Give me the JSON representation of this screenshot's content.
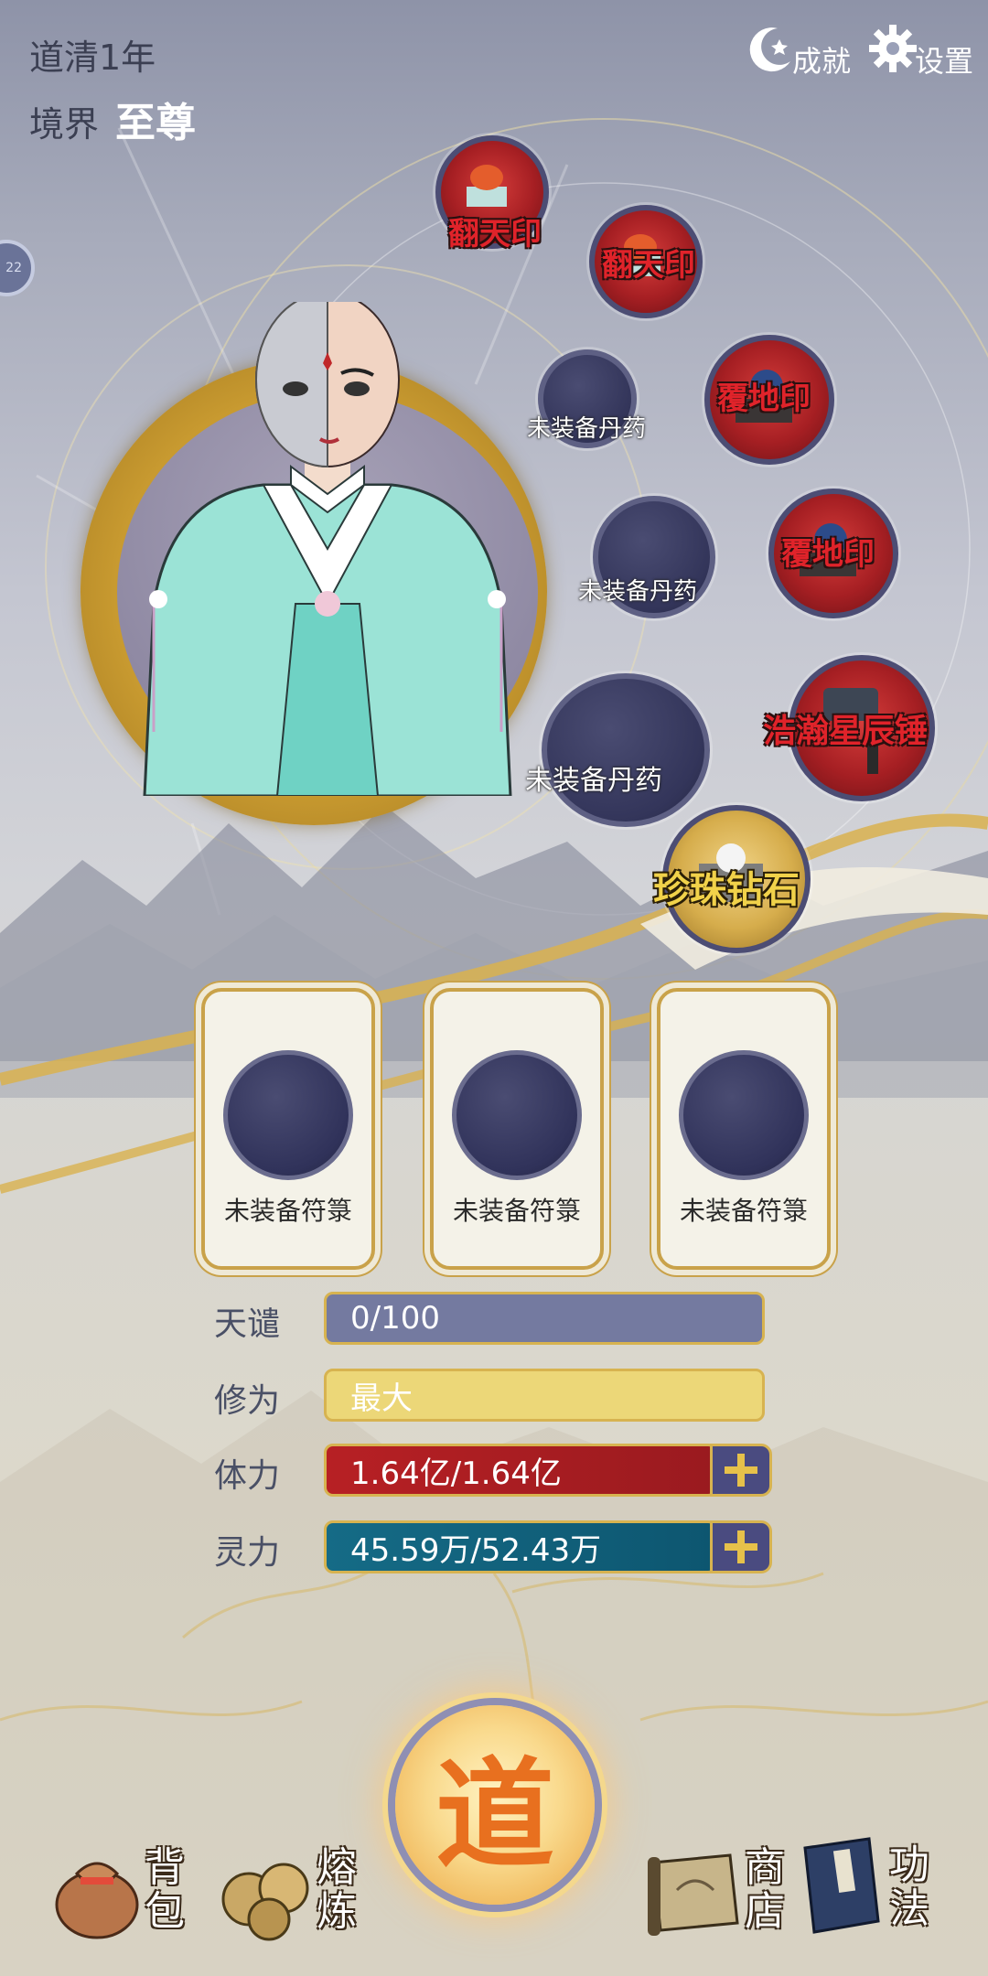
{
  "header": {
    "daoqing": "道清1年",
    "realm_label": "境界",
    "realm_value": "至尊",
    "achievement_label": "成就",
    "settings_label": "设置"
  },
  "side_tab": {
    "label": "22"
  },
  "equipment": {
    "seal1": "翻天印",
    "seal2": "翻天印",
    "earth1": "覆地印",
    "earth2": "覆地印",
    "hammer": "浩瀚星辰锤",
    "gem": "珍珠钻石",
    "pill1": "未装备丹药",
    "pill2": "未装备丹药",
    "pill3": "未装备丹药"
  },
  "talismans": [
    "未装备符箓",
    "未装备符箓",
    "未装备符箓"
  ],
  "stats": {
    "tianqian_label": "天谴",
    "tianqian_value": "0/100",
    "xiuwei_label": "修为",
    "xiuwei_value": "最大",
    "tili_label": "体力",
    "tili_value": "1.64亿/1.64亿",
    "lingli_label": "灵力",
    "lingli_value": "45.59万/52.43万"
  },
  "nav": {
    "bag_1": "背",
    "bag_2": "包",
    "smelt_1": "熔",
    "smelt_2": "炼",
    "dao": "道",
    "shop_1": "商",
    "shop_2": "店",
    "skill_1": "功",
    "skill_2": "法"
  },
  "colors": {
    "accent_gold": "#d7b350",
    "health_red": "#b72024",
    "mana_teal": "#156b86",
    "cultivation_yellow": "#ecd778",
    "wrath_gray": "#747aa0"
  }
}
